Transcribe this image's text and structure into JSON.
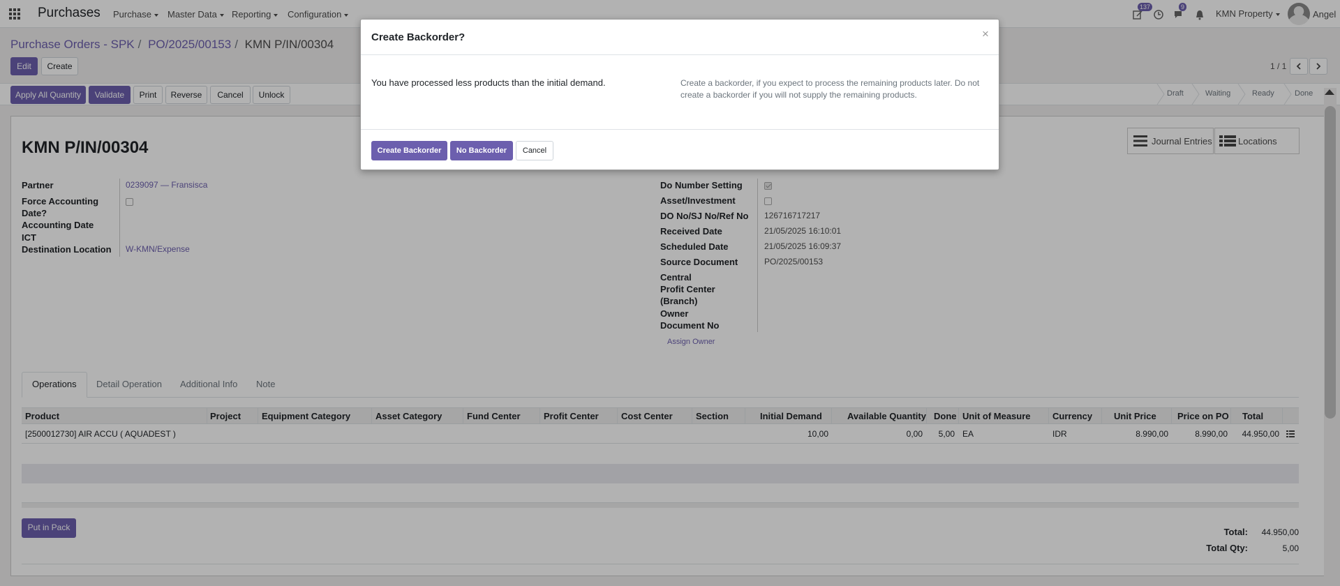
{
  "navbar": {
    "app_title": "Purchases",
    "menus": [
      "Purchase",
      "Master Data",
      "Reporting",
      "Configuration"
    ],
    "activity_count": "137",
    "messages_count": "9",
    "company": "KMN Property",
    "user": "Angel"
  },
  "control_panel": {
    "breadcrumb": [
      "Purchase Orders - SPK",
      "PO/2025/00153",
      "KMN P/IN/00304"
    ],
    "edit_label": "Edit",
    "create_label": "Create",
    "pager": "1 / 1"
  },
  "header_buttons": [
    "Apply All Quantity",
    "Validate",
    "Print",
    "Reverse",
    "Cancel",
    "Unlock"
  ],
  "stages": [
    "Draft",
    "Waiting",
    "Ready",
    "Done"
  ],
  "form": {
    "title": "KMN P/IN/00304",
    "smart_buttons": [
      "Journal Entries",
      "Locations"
    ],
    "left_fields": {
      "partner_label": "Partner",
      "partner_value": "0239097 — Fransisca",
      "force_label_1": "Force Accounting",
      "force_label_2": "Date?",
      "accounting_date_label": "Accounting Date",
      "ict_label": "ICT",
      "destination_label": "Destination Location",
      "destination_value": "W-KMN/Expense"
    },
    "right_fields": {
      "do_number_label": "Do Number Setting",
      "asset_label": "Asset/Investment",
      "do_no_label": "DO No/SJ No/Ref No",
      "do_no_value": "126716717217",
      "received_label": "Received Date",
      "received_value": "21/05/2025 16:10:01",
      "scheduled_label": "Scheduled Date",
      "scheduled_value": "21/05/2025 16:09:37",
      "source_label": "Source Document",
      "source_value": "PO/2025/00153",
      "central_label": "Central",
      "profit_label_1": "Profit Center",
      "profit_label_2": "(Branch)",
      "owner_label": "Owner",
      "document_no_label": "Document No",
      "assign_owner": "Assign Owner"
    },
    "tabs": [
      "Operations",
      "Detail Operation",
      "Additional Info",
      "Note"
    ],
    "table": {
      "headers": [
        "Product",
        "Project",
        "Equipment Category",
        "Asset Category",
        "Fund Center",
        "Profit Center",
        "Cost Center",
        "Section",
        "Initial Demand",
        "Available Quantity",
        "Done",
        "Unit of Measure",
        "Currency",
        "Unit Price",
        "Price on PO",
        "Total"
      ],
      "row": [
        "[2500012730] AIR ACCU ( AQUADEST )",
        "",
        "",
        "",
        "",
        "",
        "",
        "",
        "10,00",
        "0,00",
        "5,00",
        "EA",
        "IDR",
        "8.990,00",
        "8.990,00",
        "44.950,00"
      ]
    },
    "put_in_pack": "Put in Pack",
    "total_label": "Total:",
    "total_value": "44.950,00",
    "total_qty_label": "Total Qty:",
    "total_qty_value": "5,00"
  },
  "modal": {
    "title": "Create Backorder?",
    "close": "×",
    "message_left": "You have processed less products than the initial demand.",
    "message_right": "Create a backorder, if you expect to process the remaining products later. Do not create a backorder if you will not supply the remaining products.",
    "create_backorder": "Create Backorder",
    "no_backorder": "No Backorder",
    "cancel": "Cancel"
  },
  "colors": {
    "primary": "#6c5fae",
    "overlay": "rgba(0,0,0,0.3)"
  }
}
